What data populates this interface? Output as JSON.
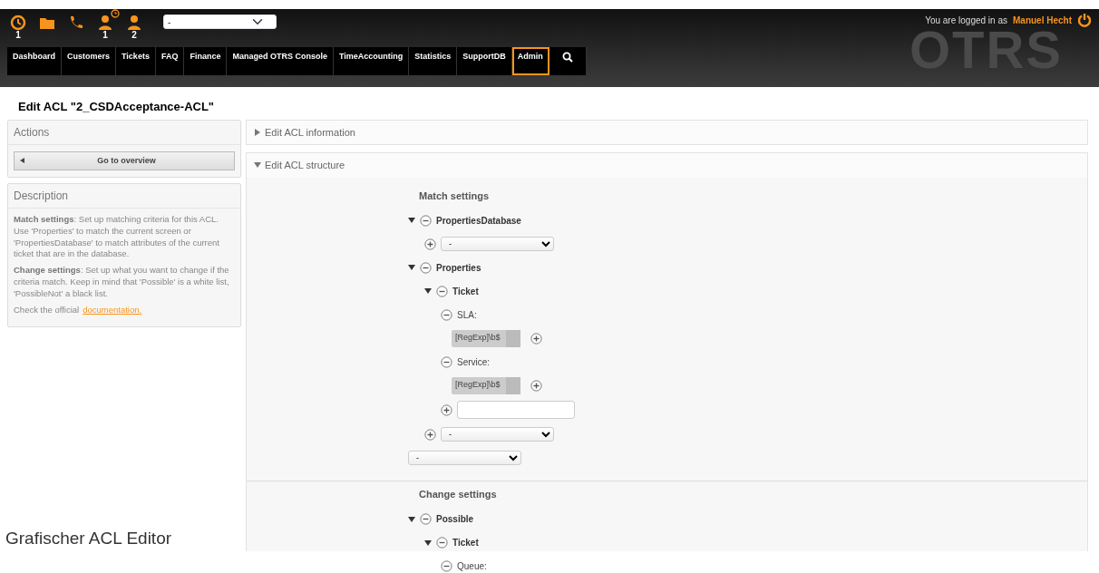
{
  "toolbar": {
    "icons": [
      {
        "kind": "clock",
        "count": "1"
      },
      {
        "kind": "folder"
      },
      {
        "kind": "phone"
      },
      {
        "kind": "person",
        "count": "1",
        "badge": true
      },
      {
        "kind": "person",
        "count": "2"
      }
    ],
    "select": "-"
  },
  "logo": "OTRS",
  "login": {
    "prefix": "You are logged in as",
    "user": "Manuel Hecht"
  },
  "nav": [
    {
      "label": "Dashboard",
      "selected": false
    },
    {
      "label": "Customers",
      "selected": false
    },
    {
      "label": "Tickets",
      "selected": false
    },
    {
      "label": "FAQ",
      "selected": false
    },
    {
      "label": "Finance",
      "selected": false
    },
    {
      "label": "Managed OTRS Console",
      "selected": false
    },
    {
      "label": "TimeAccounting",
      "selected": false
    },
    {
      "label": "Statistics",
      "selected": false
    },
    {
      "label": "SupportDB",
      "selected": false
    },
    {
      "label": "Admin",
      "selected": true
    }
  ],
  "page_title": "Edit ACL \"2_CSDAcceptance-ACL\"",
  "sidebar": {
    "actions_title": "Actions",
    "overview_button": "Go to overview",
    "description_title": "Description",
    "paragraphs": [
      "**Match settings**: Set up matching criteria for this ACL. Use 'Properties' to match the current screen or 'PropertiesDatabase' to match attributes of the current ticket that are in the database.",
      "**Change settings**: Set up what you want to change if the criteria match. Keep in mind that 'Possible' is a white list, 'PossibleNot' a black list."
    ],
    "check_text": "Check the official",
    "check_link": "documentation."
  },
  "caption": "Grafischer ACL Editor",
  "sections": [
    {
      "title": "Edit ACL information",
      "expanded": false
    },
    {
      "title": "Edit ACL structure",
      "expanded": true
    }
  ],
  "match": {
    "heading": "Match settings",
    "items": [
      {
        "kind": "node",
        "label": "PropertiesDatabase",
        "expanded": true,
        "children": [
          {
            "kind": "add-select",
            "value": "-"
          }
        ]
      },
      {
        "kind": "node",
        "label": "Properties",
        "expanded": true,
        "children": [
          {
            "kind": "node",
            "label": "Ticket",
            "expanded": true,
            "children": [
              {
                "kind": "key",
                "label": "SLA:",
                "children": [
                  {
                    "kind": "tag",
                    "value": "[RegExp]\\b$"
                  }
                ]
              },
              {
                "kind": "key",
                "label": "Service:",
                "children": [
                  {
                    "kind": "tag",
                    "value": "[RegExp]\\b$"
                  }
                ]
              },
              {
                "kind": "add-input"
              }
            ]
          },
          {
            "kind": "add-select",
            "value": "-"
          }
        ]
      },
      {
        "kind": "select",
        "value": "-"
      }
    ]
  },
  "change": {
    "heading": "Change settings",
    "items": [
      {
        "kind": "node",
        "label": "Possible",
        "expanded": true,
        "children": [
          {
            "kind": "node",
            "label": "Ticket",
            "expanded": true,
            "children": [
              {
                "kind": "key",
                "label": "Queue:"
              }
            ]
          }
        ]
      }
    ]
  }
}
